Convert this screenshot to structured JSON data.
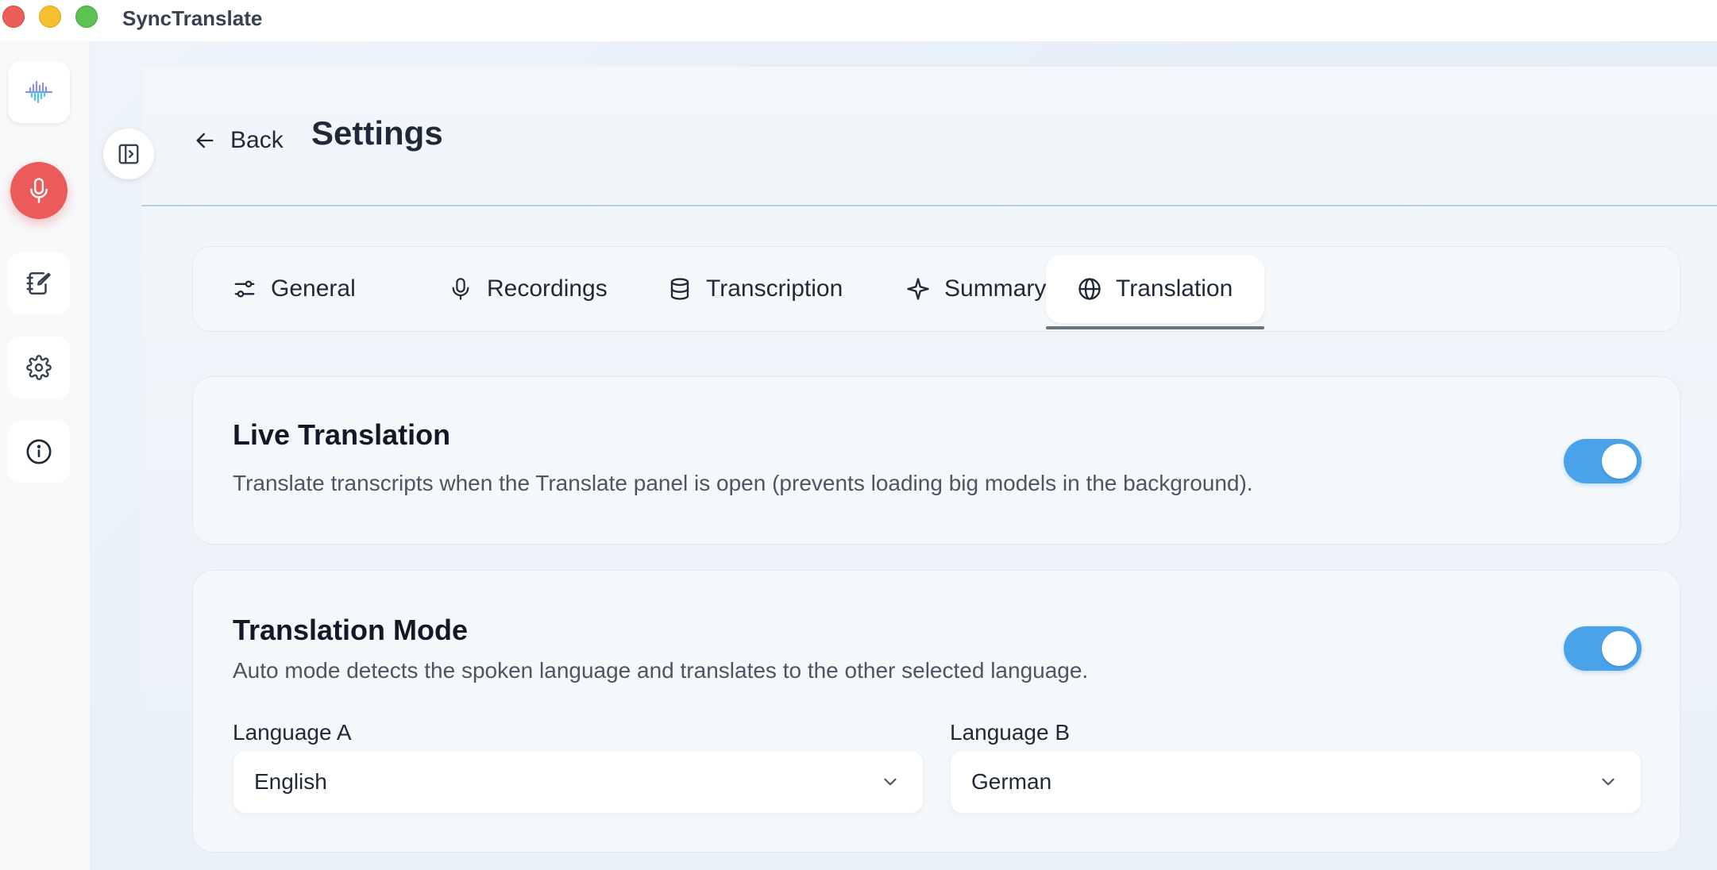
{
  "window": {
    "title": "SyncTranslate"
  },
  "sidebar": {
    "items": [
      {
        "name": "app-logo",
        "icon": "waveform-logo-icon"
      },
      {
        "name": "record",
        "icon": "microphone-icon"
      },
      {
        "name": "notes",
        "icon": "notebook-edit-icon"
      },
      {
        "name": "settings",
        "icon": "gear-icon"
      },
      {
        "name": "about",
        "icon": "info-icon"
      }
    ],
    "collapse_icon": "sidebar-toggle-icon"
  },
  "header": {
    "back_label": "Back",
    "title": "Settings"
  },
  "tabs": [
    {
      "label": "General",
      "icon": "sliders-icon"
    },
    {
      "label": "Recordings",
      "icon": "microphone-icon"
    },
    {
      "label": "Transcription",
      "icon": "database-icon"
    },
    {
      "label": "Summary",
      "icon": "sparkle-icon"
    },
    {
      "label": "Translation",
      "icon": "globe-icon",
      "active": true
    }
  ],
  "live_translation": {
    "title": "Live Translation",
    "description": "Translate transcripts when the Translate panel is open (prevents loading big models in the background).",
    "enabled": true
  },
  "translation_mode": {
    "title": "Translation Mode",
    "description": "Auto mode detects the spoken language and translates to the other selected language.",
    "enabled": true,
    "language_a_label": "Language A",
    "language_a_value": "English",
    "language_b_label": "Language B",
    "language_b_value": "German"
  },
  "colors": {
    "accent": "#4aa3ea",
    "record": "#ec5b5b"
  }
}
